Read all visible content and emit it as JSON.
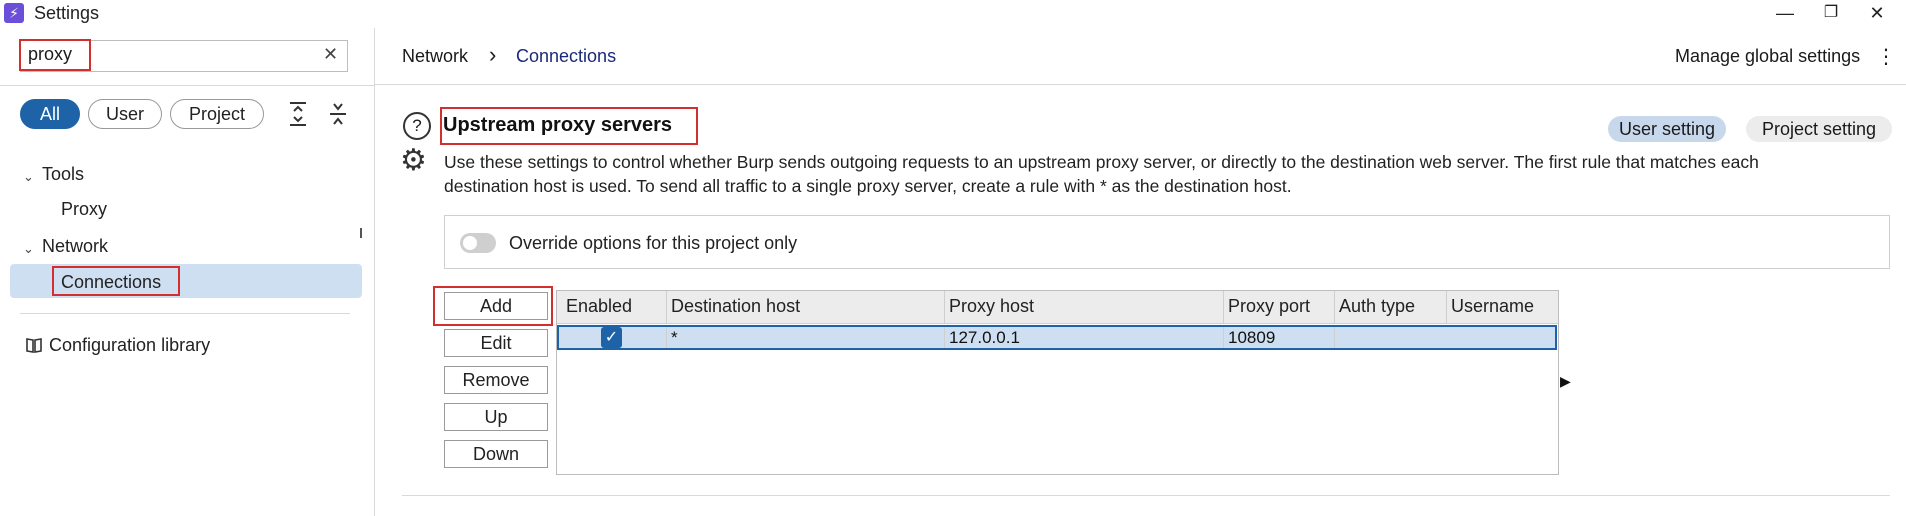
{
  "window": {
    "title": "Settings",
    "app_icon": "lightning-icon",
    "minimize": "—",
    "restore": "❐",
    "close": "✕"
  },
  "sidebar": {
    "search": {
      "value": "proxy",
      "clear_icon": "✕"
    },
    "filters": [
      {
        "label": "All",
        "active": true
      },
      {
        "label": "User",
        "active": false
      },
      {
        "label": "Project",
        "active": false
      }
    ],
    "tree": {
      "tools": {
        "label": "Tools",
        "children": [
          {
            "label": "Proxy"
          }
        ]
      },
      "network": {
        "label": "Network",
        "children": [
          {
            "label": "Connections",
            "selected": true
          }
        ]
      }
    },
    "config_library": "Configuration library"
  },
  "breadcrumb": {
    "parent": "Network",
    "separator": "›",
    "current": "Connections"
  },
  "header": {
    "manage_global": "Manage global settings",
    "more_icon": "⋮"
  },
  "section": {
    "title": "Upstream proxy servers",
    "help_icon": "?",
    "settings_icon": "⚙",
    "user_setting": "User setting",
    "project_setting": "Project setting",
    "description_1": "Use these settings to control whether Burp sends outgoing requests to an upstream proxy server, or directly to the destination web server. The first rule that matches each",
    "description_2": "destination host is used. To send all traffic to a single proxy server, create a rule with * as the destination host.",
    "override_label": "Override options for this project only",
    "override_on": false
  },
  "buttons": {
    "add": "Add",
    "edit": "Edit",
    "remove": "Remove",
    "up": "Up",
    "down": "Down"
  },
  "table": {
    "columns": [
      "Enabled",
      "Destination host",
      "Proxy host",
      "Proxy port",
      "Auth type",
      "Username"
    ],
    "rows": [
      {
        "enabled": true,
        "destination_host": "*",
        "proxy_host": "127.0.0.1",
        "proxy_port": "10809",
        "auth_type": "",
        "username": ""
      }
    ],
    "scroll_arrow": "▶"
  },
  "colors": {
    "accent": "#1e63a8",
    "selection": "#cfdff2",
    "highlight_border": "#d32f2f"
  }
}
